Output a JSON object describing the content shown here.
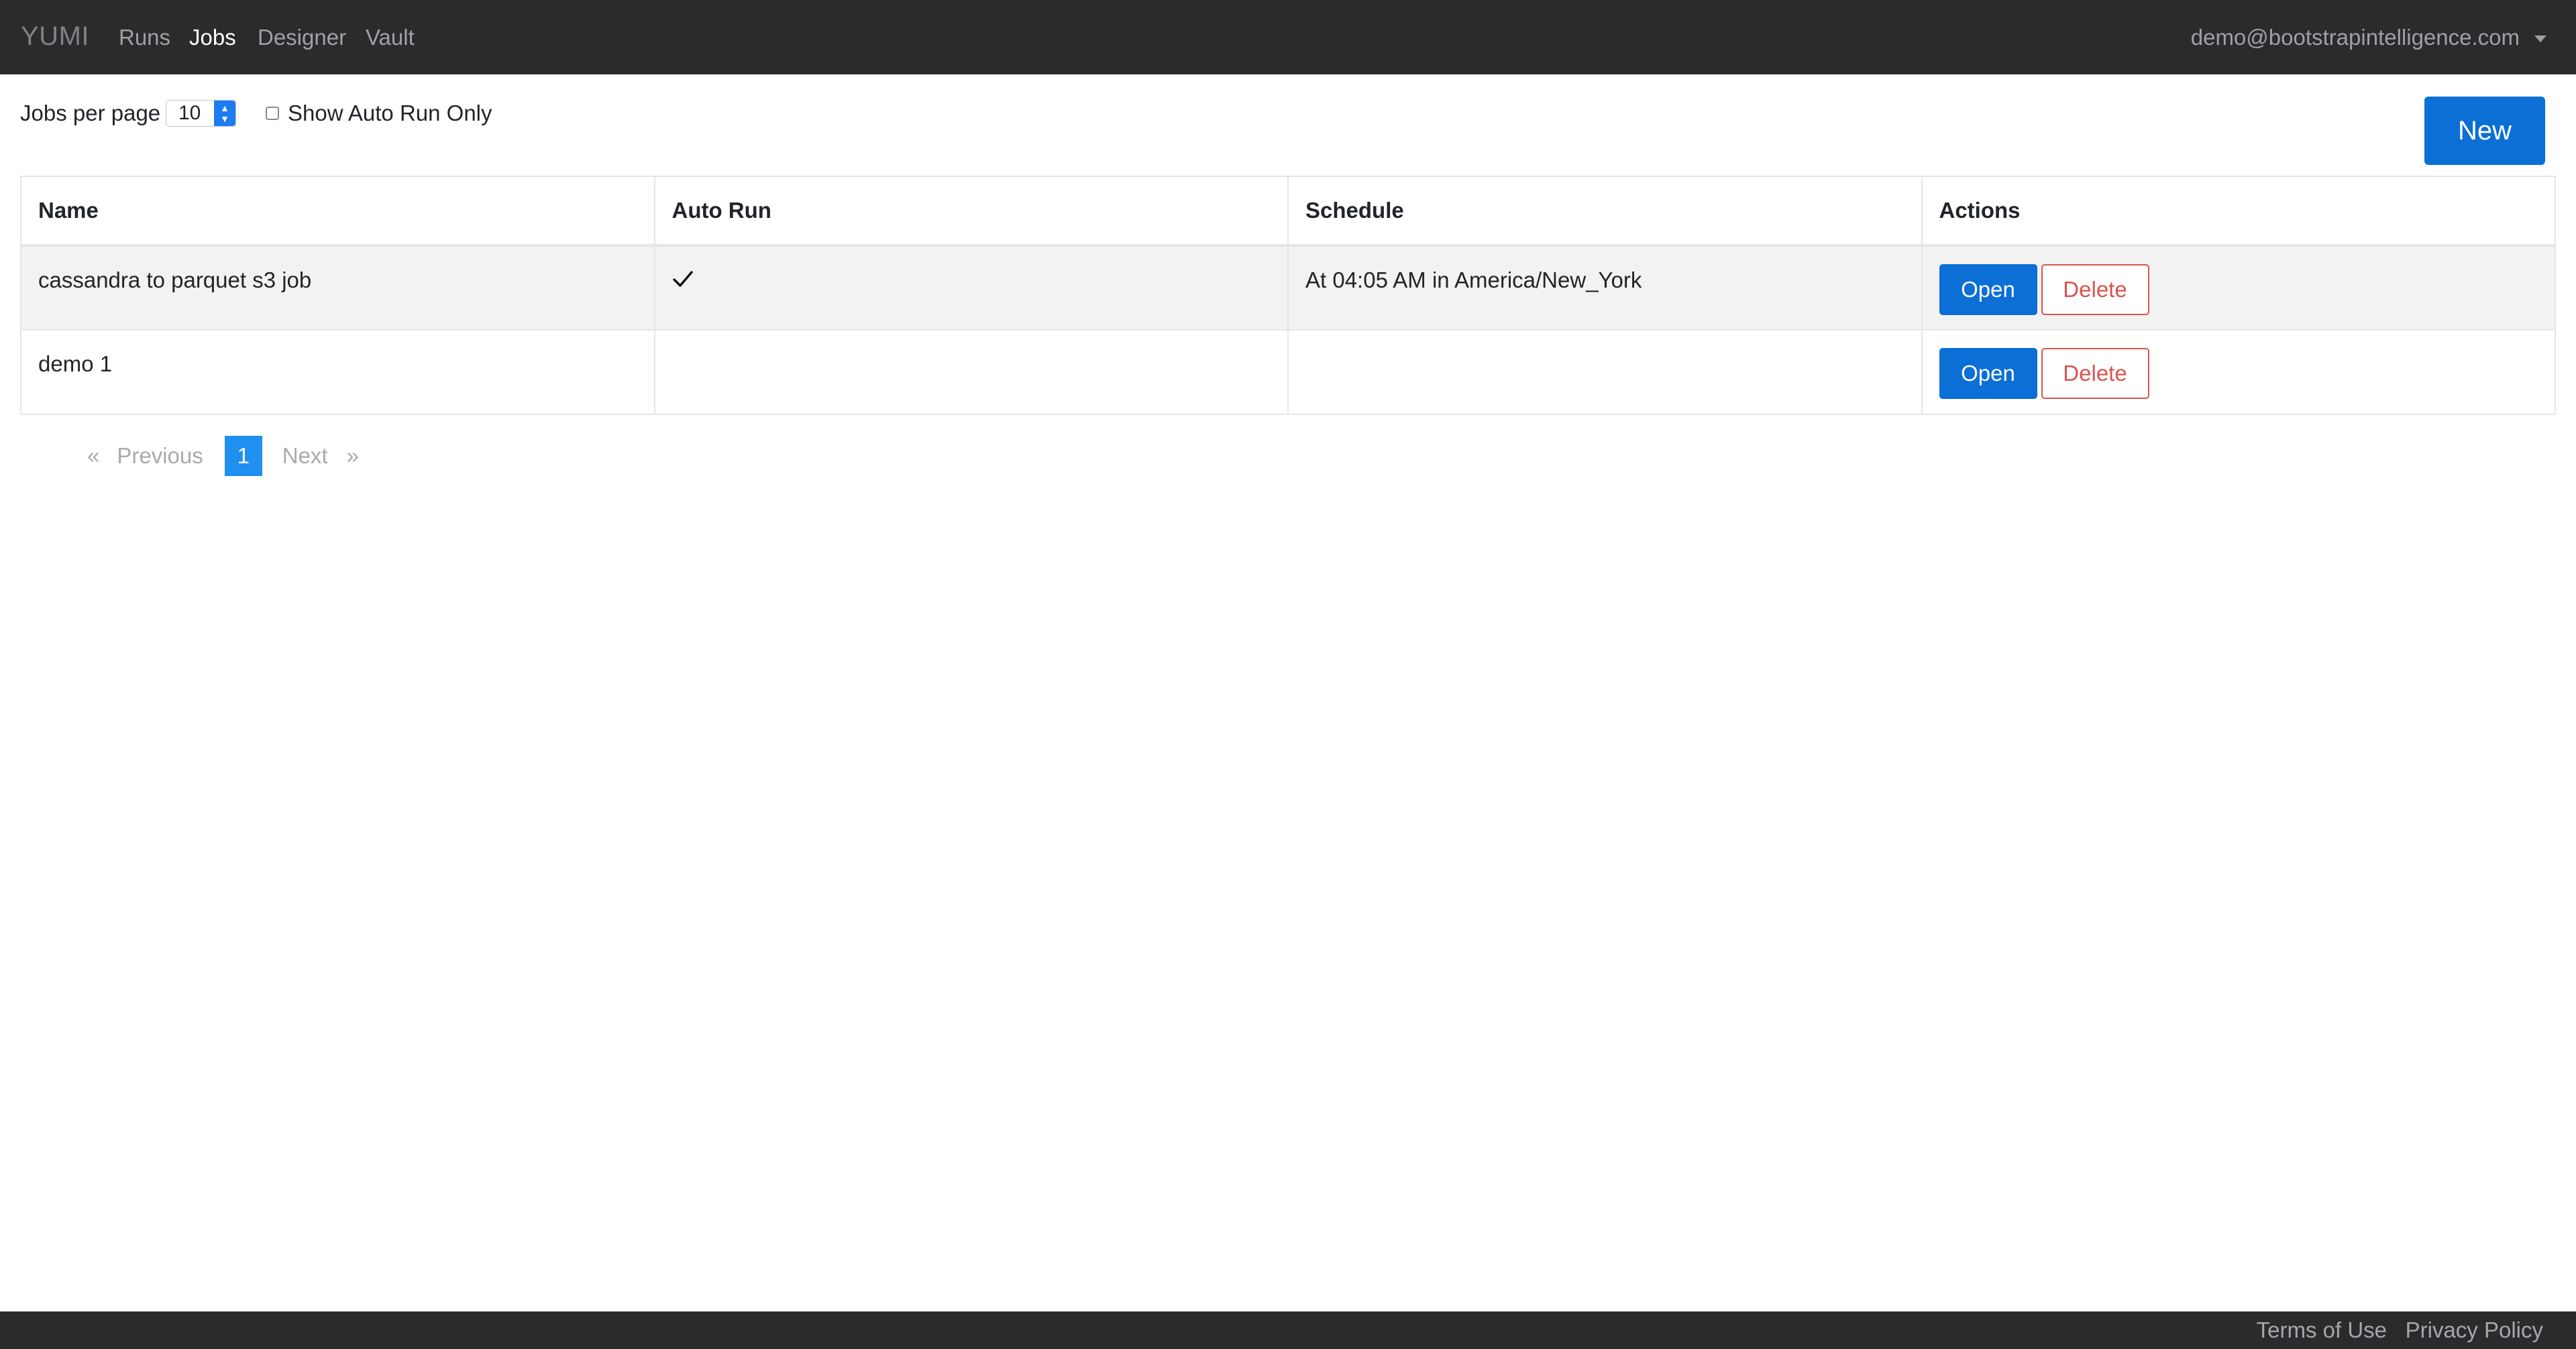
{
  "navbar": {
    "brand": "YUMI",
    "links": [
      {
        "label": "Runs",
        "active": false
      },
      {
        "label": "Jobs",
        "active": true
      },
      {
        "label": "Designer",
        "active": false
      },
      {
        "label": "Vault",
        "active": false
      }
    ],
    "user_email": "demo@bootstrapintelligence.com",
    "user_menu_icon": "caret-down-icon"
  },
  "toolbar": {
    "per_page_label": "Jobs per page",
    "per_page_value": "10",
    "select_icon": "up-down-arrows-icon",
    "auto_run_label": "Show Auto Run Only",
    "auto_run_checked": false,
    "new_label": "New"
  },
  "table": {
    "headers": [
      "Name",
      "Auto Run",
      "Schedule",
      "Actions"
    ],
    "rows": [
      {
        "name": "cassandra to parquet s3 job",
        "auto_run": true,
        "auto_run_icon": "checkmark-icon",
        "schedule": "At 04:05 AM in America/New_York",
        "open_label": "Open",
        "delete_label": "Delete"
      },
      {
        "name": "demo 1",
        "auto_run": false,
        "schedule": "",
        "open_label": "Open",
        "delete_label": "Delete"
      }
    ]
  },
  "pagination": {
    "first": "«",
    "previous": "Previous",
    "current_page": "1",
    "next": "Next",
    "last": "»"
  },
  "footer": {
    "terms": "Terms of Use",
    "privacy": "Privacy Policy"
  },
  "colors": {
    "navbar_bg": "#2a2b2d",
    "primary": "#0b6fd6",
    "danger": "#d9534f",
    "active_page": "#1f8ff0",
    "row_stripe": "#f2f2f2"
  }
}
